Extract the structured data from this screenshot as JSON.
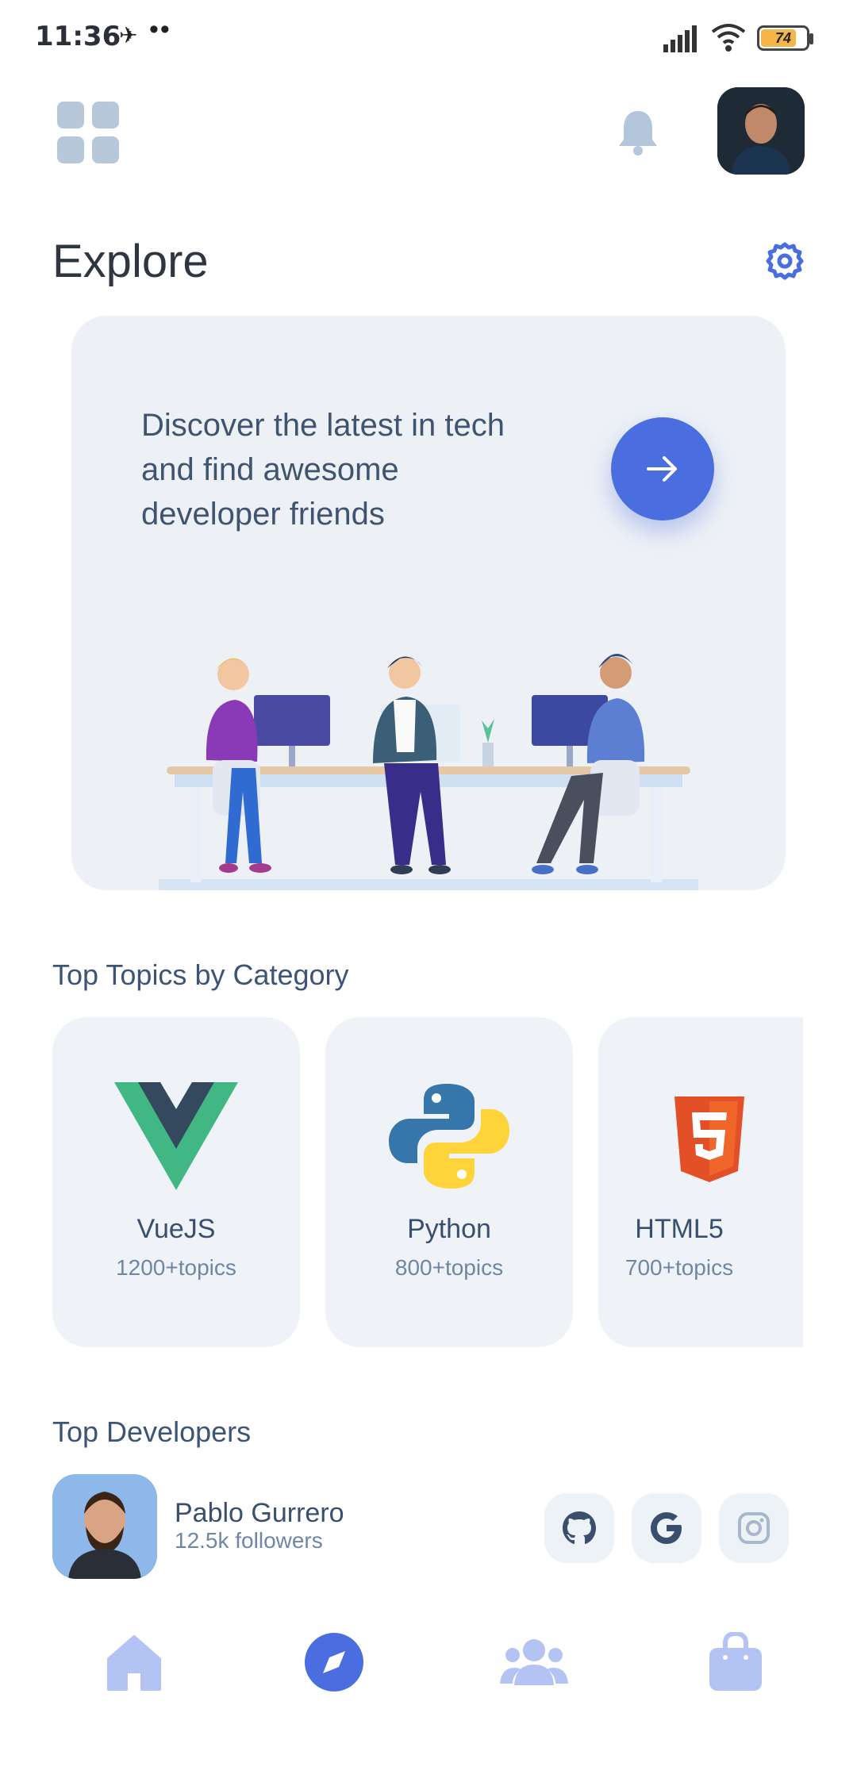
{
  "status_bar": {
    "time": "11:36",
    "battery_level": "74",
    "battery_fill": 0.74
  },
  "header": {
    "menu_icon": "grid-menu-icon",
    "notification_icon": "bell-icon",
    "avatar": "profile-avatar"
  },
  "explore": {
    "title": "Explore",
    "settings_icon": "gear-icon"
  },
  "hero": {
    "text": "Discover the latest in tech and find awesome developer friends",
    "button_icon": "arrow-right-icon"
  },
  "topics": {
    "title": "Top Topics by Category",
    "items": [
      {
        "name": "VueJS",
        "count": "1200+topics",
        "icon": "vuejs-logo-icon"
      },
      {
        "name": "Python",
        "count": "800+topics",
        "icon": "python-logo-icon"
      },
      {
        "name": "HTML5",
        "count": "700+topics",
        "icon": "html5-logo-icon"
      }
    ]
  },
  "developers": {
    "title": "Top Developers",
    "items": [
      {
        "name": "Pablo Gurrero",
        "followers": "12.5k followers",
        "socials": [
          "github-icon",
          "google-icon",
          "instagram-icon"
        ]
      }
    ]
  },
  "bottom_nav": {
    "items": [
      "home-icon",
      "explore-compass-icon",
      "people-icon",
      "shop-bag-icon"
    ],
    "active": "explore-compass-icon"
  },
  "colors": {
    "accent": "#4a6ee0",
    "nav_inactive": "#b3c3f3",
    "card_bg": "#eff3f8"
  }
}
